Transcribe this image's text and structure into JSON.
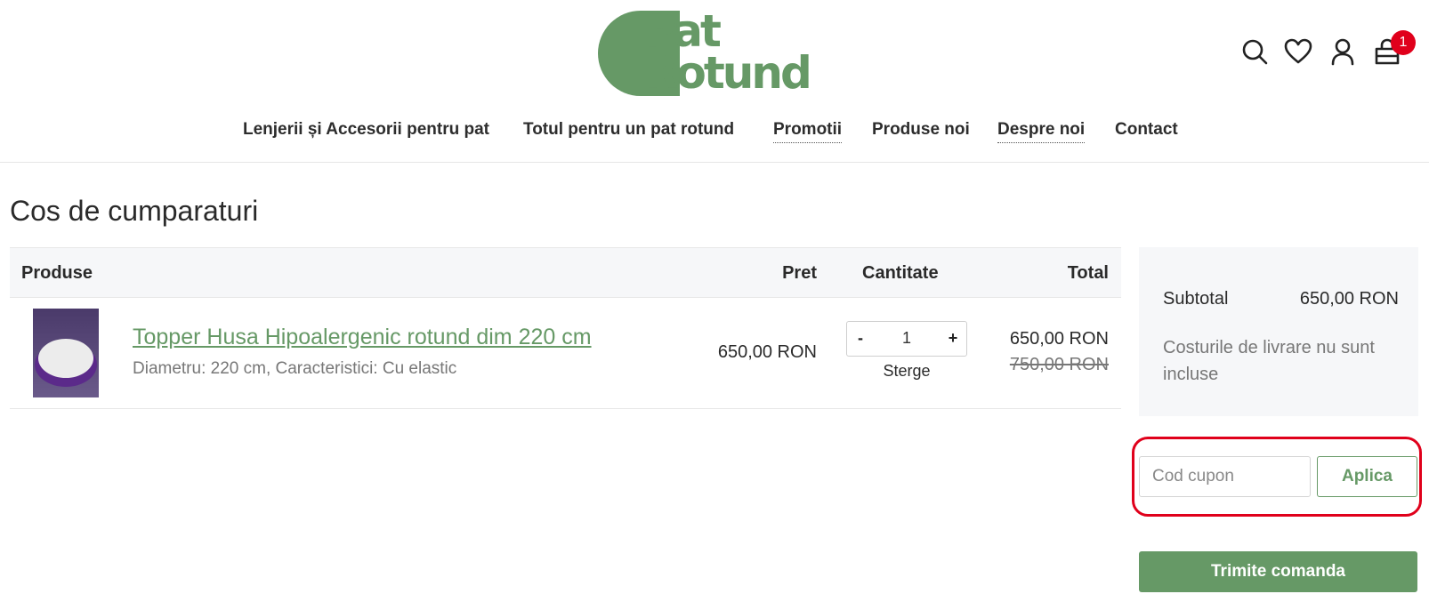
{
  "brand": {
    "logo_line1": "Pat",
    "logo_line2": "Rotund",
    "color": "#669966"
  },
  "header": {
    "icons": [
      "search-icon",
      "heart-icon",
      "user-icon",
      "cart-icon"
    ],
    "cart_count": "1"
  },
  "nav": {
    "items": [
      {
        "label": "Lenjerii și Accesorii pentru pat"
      },
      {
        "label": "Totul pentru un pat rotund"
      },
      {
        "label": "Promotii"
      },
      {
        "label": "Produse noi"
      },
      {
        "label": "Despre noi"
      },
      {
        "label": "Contact"
      }
    ]
  },
  "page": {
    "title": "Cos de cumparaturi"
  },
  "cart": {
    "columns": {
      "products": "Produse",
      "price": "Pret",
      "quantity": "Cantitate",
      "total": "Total"
    },
    "items": [
      {
        "name": "Topper Husa Hipoalergenic rotund dim 220 cm",
        "variant": "Diametru: 220 cm, Caracteristici: Cu elastic",
        "price": "650,00 RON",
        "quantity": "1",
        "qty_minus": "-",
        "qty_plus": "+",
        "remove_label": "Sterge",
        "total": "650,00 RON",
        "total_old": "750,00 RON"
      }
    ]
  },
  "summary": {
    "subtotal_label": "Subtotal",
    "subtotal_value": "650,00 RON",
    "shipping_note": "Costurile de livrare nu sunt incluse",
    "coupon_placeholder": "Cod cupon",
    "coupon_button": "Aplica",
    "submit_button": "Trimite comanda"
  },
  "colors": {
    "accent": "#669966",
    "highlight": "#e0001b",
    "badge": "#e0001b"
  }
}
